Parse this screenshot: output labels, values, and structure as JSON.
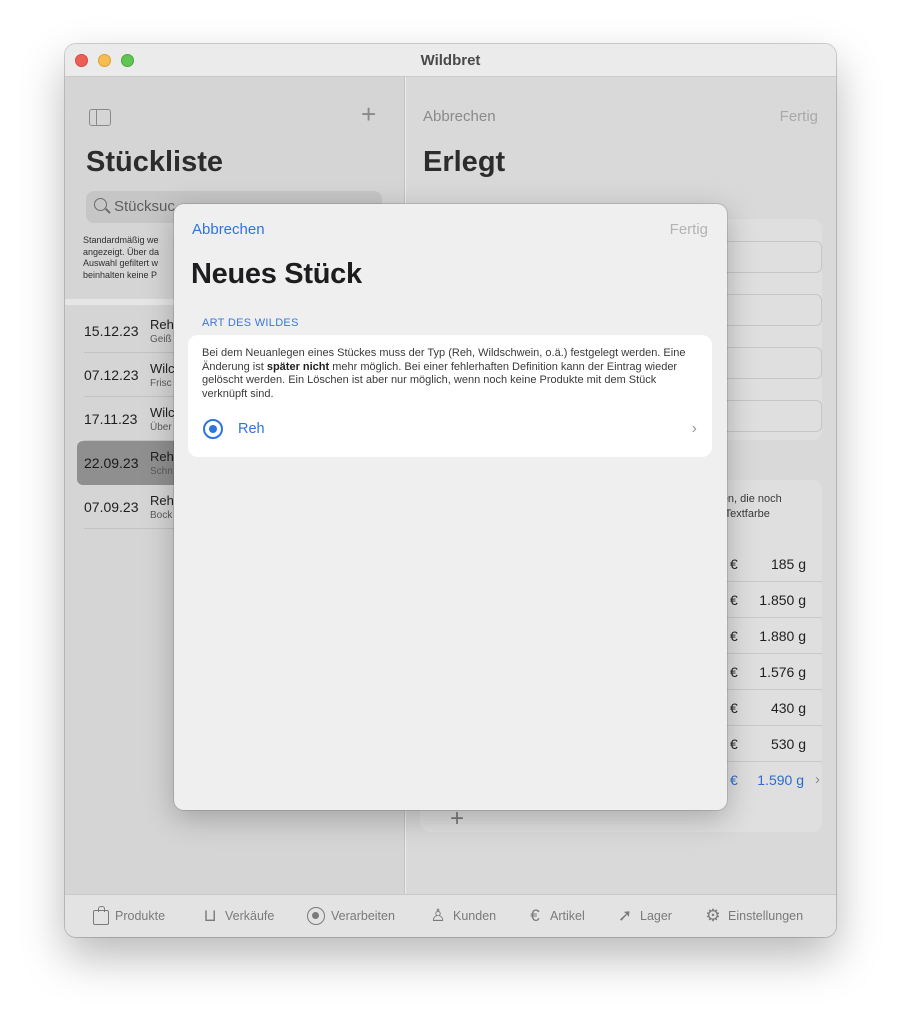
{
  "window": {
    "title": "Wildbret"
  },
  "sidebar": {
    "title": "Stückliste",
    "search_text": "Stücksuc",
    "hint_lines": [
      "Standardmäßig we",
      "angezeigt. Über da",
      "Auswahl gefiltert w",
      "beinhalten keine P"
    ],
    "items": [
      {
        "date": "15.12.23",
        "name": "Reh",
        "sub": "Geiß"
      },
      {
        "date": "07.12.23",
        "name": "Wilc",
        "sub": "Frisc"
      },
      {
        "date": "17.11.23",
        "name": "Wilc",
        "sub": "Über"
      },
      {
        "date": "22.09.23",
        "name": "Reh",
        "sub": "Schn",
        "selected": true
      },
      {
        "date": "07.09.23",
        "name": "Reh",
        "sub": "Bock"
      }
    ]
  },
  "detail": {
    "cancel_label": "Abbrechen",
    "done_label": "Fertig",
    "title": "Erlegt",
    "note_lines": [
      "rden, die noch",
      "er Textfarbe"
    ],
    "weights": [
      {
        "currency": "€",
        "value": "185 g"
      },
      {
        "currency": "€",
        "value": "1.850 g"
      },
      {
        "currency": "€",
        "value": "1.880 g"
      },
      {
        "currency": "€",
        "value": "1.576 g"
      },
      {
        "currency": "€",
        "value": "430 g"
      },
      {
        "currency": "€",
        "value": "530 g"
      },
      {
        "currency": "€",
        "value": "1.590 g",
        "highlight": true
      }
    ]
  },
  "tabs": [
    {
      "label": "Produkte",
      "icon": "bag-icon"
    },
    {
      "label": "Verkäufe",
      "icon": "cart-icon"
    },
    {
      "label": "Verarbeiten",
      "icon": "target-icon"
    },
    {
      "label": "Kunden",
      "icon": "person-icon"
    },
    {
      "label": "Artikel",
      "icon": "euro-icon"
    },
    {
      "label": "Lager",
      "icon": "location-icon"
    },
    {
      "label": "Einstellungen",
      "icon": "gear-icon"
    }
  ],
  "modal": {
    "cancel_label": "Abbrechen",
    "done_label": "Fertig",
    "title": "Neues Stück",
    "section_header": "ART DES WILDES",
    "desc_part1": "Bei dem Neuanlegen eines Stückes muss der Typ (Reh, Wildschwein, o.ä.) festgelegt werden. Eine Änderung ist ",
    "desc_bold": "später nicht",
    "desc_part2": " mehr möglich. Bei einer fehlerhaften Definition kann der Eintrag wieder gelöscht werden. Ein Löschen ist aber nur möglich, wenn noch keine Produkte mit dem Stück verknüpft sind.",
    "type_value": "Reh"
  },
  "colors": {
    "accent": "#2e74e0",
    "section": "#3b78d6"
  }
}
